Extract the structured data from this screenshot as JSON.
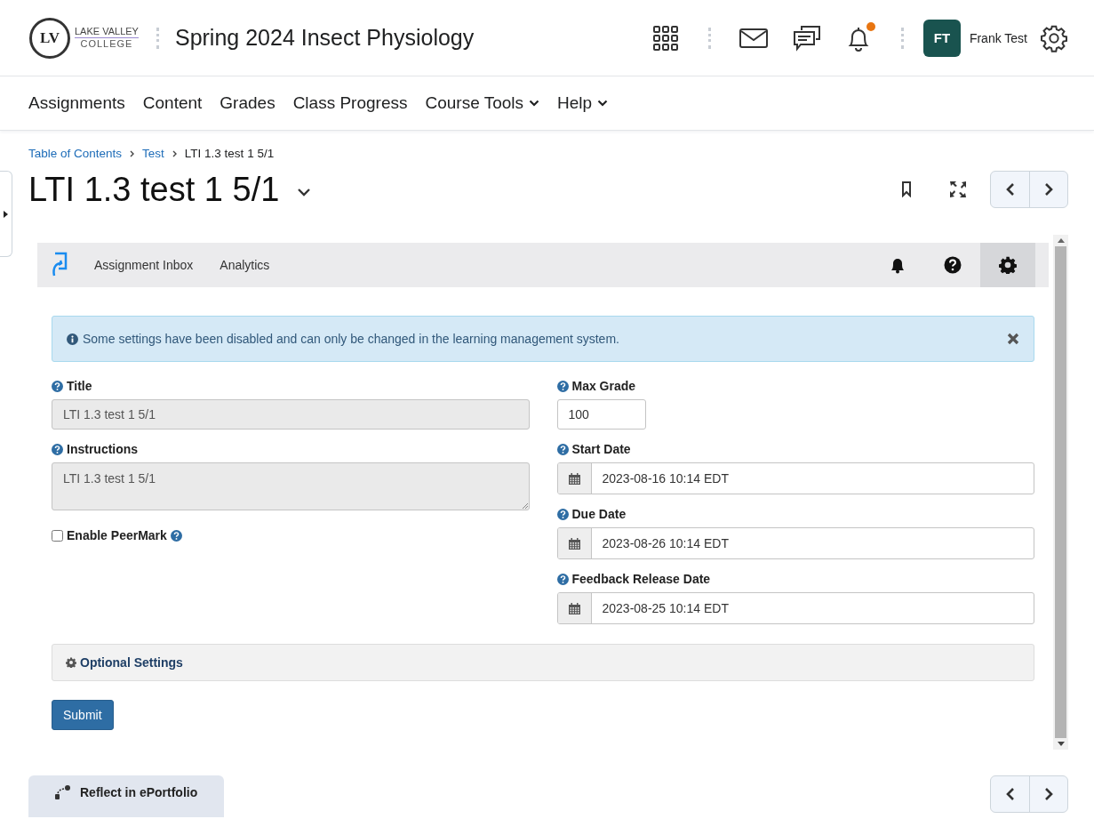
{
  "header": {
    "logo": {
      "monogram": "LV",
      "name": "LAKE VALLEY",
      "subtitle": "COLLEGE"
    },
    "course_title": "Spring 2024 Insect Physiology",
    "notifications_unread": true,
    "user": {
      "initials": "FT",
      "name": "Frank Test"
    }
  },
  "nav": [
    {
      "label": "Assignments",
      "has_menu": false
    },
    {
      "label": "Content",
      "has_menu": false
    },
    {
      "label": "Grades",
      "has_menu": false
    },
    {
      "label": "Class Progress",
      "has_menu": false
    },
    {
      "label": "Course Tools",
      "has_menu": true
    },
    {
      "label": "Help",
      "has_menu": true
    }
  ],
  "breadcrumb": [
    {
      "label": "Table of Contents",
      "kind": "link"
    },
    {
      "label": "Test",
      "kind": "link"
    },
    {
      "label": "LTI 1.3 test 1 5/1",
      "kind": "current"
    }
  ],
  "page_title": "LTI 1.3 test 1 5/1",
  "tool": {
    "tabs": [
      {
        "label": "Assignment Inbox"
      },
      {
        "label": "Analytics"
      }
    ],
    "settings_selected": true,
    "alert": "Some settings have been disabled and can only be changed in the learning management system.",
    "left_fields": [
      {
        "kind": "text",
        "label": "Title",
        "value": "LTI 1.3 test 1 5/1",
        "disabled": true
      },
      {
        "kind": "textarea",
        "label": "Instructions",
        "value": "LTI 1.3 test 1 5/1",
        "disabled": true
      },
      {
        "kind": "checkbox",
        "label": "Enable PeerMark",
        "checked": false
      }
    ],
    "right_fields": [
      {
        "kind": "number",
        "label": "Max Grade",
        "value": "100",
        "disabled": false
      },
      {
        "kind": "date",
        "label": "Start Date",
        "value": "2023-08-16 10:14 EDT"
      },
      {
        "kind": "date",
        "label": "Due Date",
        "value": "2023-08-26 10:14 EDT"
      },
      {
        "kind": "date",
        "label": "Feedback Release Date",
        "value": "2023-08-25 10:14 EDT"
      }
    ],
    "optional_settings": "Optional Settings",
    "submit": "Submit"
  },
  "footer": {
    "reflect": "Reflect in ePortfolio"
  }
}
